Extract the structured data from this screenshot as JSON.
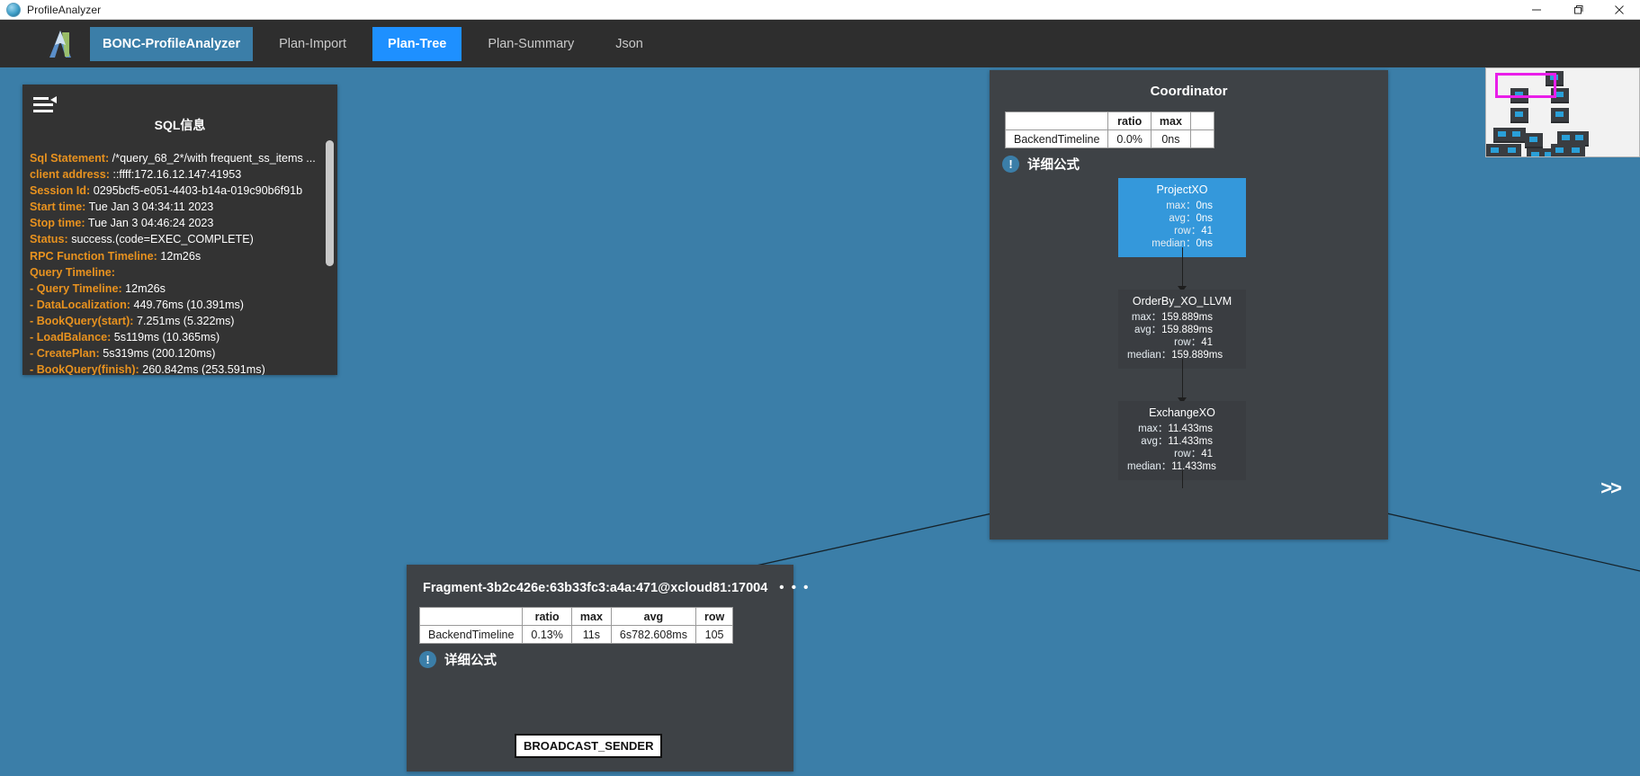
{
  "window": {
    "title": "ProfileAnalyzer",
    "app_icon": "profile-analyzer-icon",
    "minimize_label": "–",
    "maximize_label": "❐",
    "close_label": "✕"
  },
  "nav": {
    "logo": "bonc-logo-icon",
    "tabs": [
      {
        "label": "BONC-ProfileAnalyzer",
        "state": "brand"
      },
      {
        "label": "Plan-Import",
        "state": "normal"
      },
      {
        "label": "Plan-Tree",
        "state": "active"
      },
      {
        "label": "Plan-Summary",
        "state": "normal"
      },
      {
        "label": "Json",
        "state": "normal"
      }
    ]
  },
  "sql_panel": {
    "menu_icon": "collapse-menu-icon",
    "title": "SQL信息",
    "lines": [
      {
        "key": "Sql Statement:",
        "value": "/*query_68_2*/with frequent_ss_items ..."
      },
      {
        "key": "client address:",
        "value": "::ffff:172.16.12.147:41953"
      },
      {
        "key": "Session Id:",
        "value": "0295bcf5-e051-4403-b14a-019c90b6f91b"
      },
      {
        "key": "Start time:",
        "value": "Tue Jan 3 04:34:11 2023"
      },
      {
        "key": "Stop time:",
        "value": "Tue Jan 3 04:46:24 2023"
      },
      {
        "key": "Status:",
        "value": "success.(code=EXEC_COMPLETE)"
      },
      {
        "key": "RPC Function Timeline:",
        "value": "12m26s"
      },
      {
        "key": "Query Timeline:",
        "value": ""
      },
      {
        "key": "- Query Timeline:",
        "value": "12m26s"
      },
      {
        "key": "- DataLocalization:",
        "value": "449.76ms (10.391ms)"
      },
      {
        "key": "- BookQuery(start):",
        "value": "7.251ms (5.322ms)"
      },
      {
        "key": "- LoadBalance:",
        "value": "5s119ms (10.365ms)"
      },
      {
        "key": "- CreatePlan:",
        "value": "5s319ms (200.120ms)"
      },
      {
        "key": "- BookQuery(finish):",
        "value": "260.842ms (253.591ms)"
      }
    ],
    "scrollbar": "vertical-scrollbar"
  },
  "coordinator": {
    "title": "Coordinator",
    "table": {
      "headers": [
        "",
        "ratio",
        "max",
        ""
      ],
      "rows": [
        {
          "label": "BackendTimeline",
          "ratio": "0.0%",
          "max": "0ns",
          "extra": ""
        }
      ]
    },
    "formula": {
      "badge": "!",
      "label": "详细公式"
    },
    "nodes": [
      {
        "title": "ProjectXO",
        "style": "blue",
        "stats": [
          {
            "k": "max：",
            "v": "0ns"
          },
          {
            "k": "avg：",
            "v": "0ns"
          },
          {
            "k": "row：",
            "v": "41"
          },
          {
            "k": "median：",
            "v": "0ns"
          }
        ]
      },
      {
        "title": "OrderBy_XO_LLVM",
        "style": "dark",
        "stats": [
          {
            "k": "max：",
            "v": "159.889ms"
          },
          {
            "k": "avg：",
            "v": "159.889ms"
          },
          {
            "k": "row：",
            "v": "41"
          },
          {
            "k": "median：",
            "v": "159.889ms"
          }
        ]
      },
      {
        "title": "ExchangeXO",
        "style": "dark",
        "stats": [
          {
            "k": "max：",
            "v": "11.433ms"
          },
          {
            "k": "avg：",
            "v": "11.433ms"
          },
          {
            "k": "row：",
            "v": "41"
          },
          {
            "k": "median：",
            "v": "11.433ms"
          }
        ]
      }
    ]
  },
  "minimap": {
    "name": "plan-tree-minimap",
    "viewport_color": "#e91ee9"
  },
  "expander": {
    "label": ">>"
  },
  "fragment": {
    "title": "Fragment-3b2c426e:63b33fc3:a4a:471@xcloud81:17004",
    "menu_dots": "• • •",
    "table": {
      "headers": [
        "",
        "ratio",
        "max",
        "avg",
        "row"
      ],
      "rows": [
        {
          "label": "BackendTimeline",
          "ratio": "0.13%",
          "max": "11s",
          "avg": "6s782.608ms",
          "row": "105"
        }
      ]
    },
    "formula": {
      "badge": "!",
      "label": "详细公式"
    },
    "inner_node": "BROADCAST_SENDER"
  }
}
